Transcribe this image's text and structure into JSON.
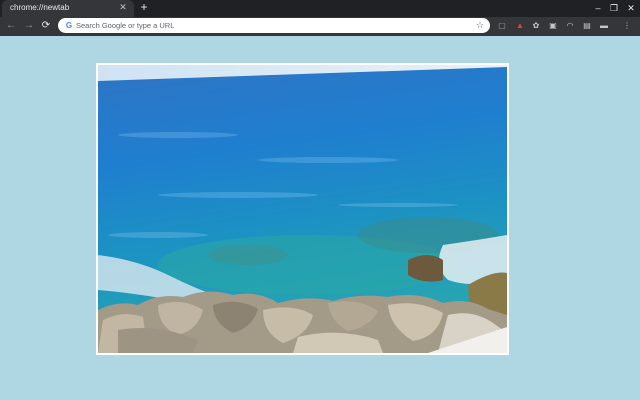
{
  "tab": {
    "title": "chrome://newtab",
    "close_icon": "close-icon"
  },
  "window_controls": {
    "minimize": "–",
    "restore": "❐",
    "close": "✕"
  },
  "toolbar": {
    "back_icon": "←",
    "forward_icon": "→",
    "reload_icon": "⟳",
    "omnibox": {
      "placeholder": "Search Google or type a URL",
      "value": "",
      "google_letter": "G"
    },
    "bookmark_icon": "☆"
  },
  "extensions": [
    "extension-icon-1",
    "extension-icon-2",
    "extension-icon-3",
    "extension-icon-4",
    "extension-icon-5",
    "extension-icon-6",
    "extension-icon-7",
    "extension-icon-8"
  ],
  "menu_icon": "⋮",
  "colors": {
    "page_bg": "#aed6e3",
    "tabstrip": "#202124",
    "toolbar": "#35363a"
  }
}
